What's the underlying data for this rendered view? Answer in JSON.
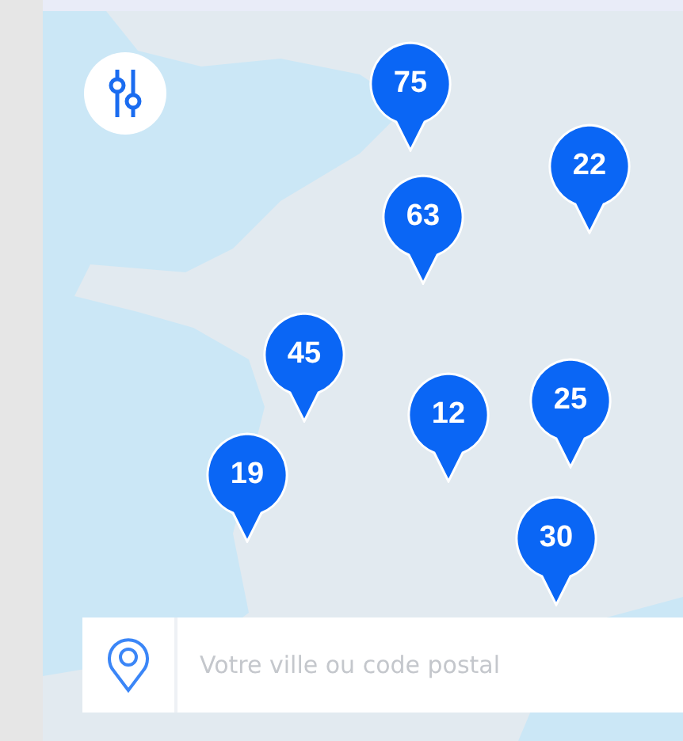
{
  "map": {
    "clusters": [
      {
        "count": "75"
      },
      {
        "count": "22"
      },
      {
        "count": "63"
      },
      {
        "count": "45"
      },
      {
        "count": "12"
      },
      {
        "count": "25"
      },
      {
        "count": "19"
      },
      {
        "count": "30"
      }
    ]
  },
  "search": {
    "placeholder": "Votre ville ou code postal"
  }
}
